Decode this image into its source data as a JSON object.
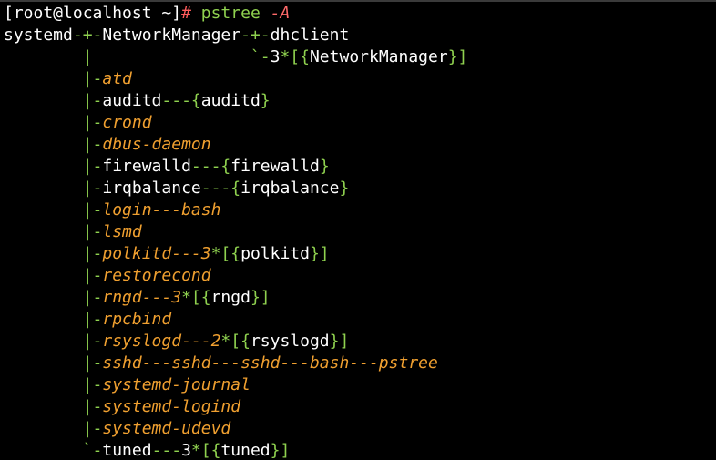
{
  "colors": {
    "background": "#000000",
    "default_text": "#ffffff",
    "tree_branch": "#8fd14f",
    "user_thread": "#f0a030",
    "prompt_hash": "#ff5c5c",
    "command": "#8fd14f",
    "argument": "#ff6a6a"
  },
  "terminal": {
    "lines": [
      [
        {
          "t": "[root@localhost ~]",
          "c": "default_text"
        },
        {
          "t": "#",
          "c": "prompt_hash"
        },
        {
          "t": " pstree ",
          "c": "command"
        },
        {
          "t": "-A",
          "c": "argument",
          "i": true
        }
      ],
      [
        {
          "t": "systemd",
          "c": "default_text"
        },
        {
          "t": "-+-",
          "c": "tree_branch"
        },
        {
          "t": "NetworkManager",
          "c": "default_text"
        },
        {
          "t": "-+-",
          "c": "tree_branch"
        },
        {
          "t": "dhclient",
          "c": "default_text"
        }
      ],
      [
        {
          "t": "        |                `-",
          "c": "tree_branch"
        },
        {
          "t": "3",
          "c": "default_text"
        },
        {
          "t": "*[{",
          "c": "tree_branch"
        },
        {
          "t": "NetworkManager",
          "c": "default_text"
        },
        {
          "t": "}]",
          "c": "tree_branch"
        }
      ],
      [
        {
          "t": "        |-",
          "c": "tree_branch"
        },
        {
          "t": "atd",
          "c": "user_thread",
          "i": true
        }
      ],
      [
        {
          "t": "        |-",
          "c": "tree_branch"
        },
        {
          "t": "auditd",
          "c": "default_text"
        },
        {
          "t": "---{",
          "c": "tree_branch"
        },
        {
          "t": "auditd",
          "c": "default_text"
        },
        {
          "t": "}",
          "c": "tree_branch"
        }
      ],
      [
        {
          "t": "        |-",
          "c": "tree_branch"
        },
        {
          "t": "crond",
          "c": "user_thread",
          "i": true
        }
      ],
      [
        {
          "t": "        |-",
          "c": "tree_branch"
        },
        {
          "t": "dbus-daemon",
          "c": "user_thread",
          "i": true
        }
      ],
      [
        {
          "t": "        |-",
          "c": "tree_branch"
        },
        {
          "t": "firewalld",
          "c": "default_text"
        },
        {
          "t": "---{",
          "c": "tree_branch"
        },
        {
          "t": "firewalld",
          "c": "default_text"
        },
        {
          "t": "}",
          "c": "tree_branch"
        }
      ],
      [
        {
          "t": "        |-",
          "c": "tree_branch"
        },
        {
          "t": "irqbalance",
          "c": "default_text"
        },
        {
          "t": "---{",
          "c": "tree_branch"
        },
        {
          "t": "irqbalance",
          "c": "default_text"
        },
        {
          "t": "}",
          "c": "tree_branch"
        }
      ],
      [
        {
          "t": "        |-",
          "c": "tree_branch"
        },
        {
          "t": "login---bash",
          "c": "user_thread",
          "i": true
        }
      ],
      [
        {
          "t": "        |-",
          "c": "tree_branch"
        },
        {
          "t": "lsmd",
          "c": "user_thread",
          "i": true
        }
      ],
      [
        {
          "t": "        |-",
          "c": "tree_branch"
        },
        {
          "t": "polkitd---3",
          "c": "user_thread",
          "i": true
        },
        {
          "t": "*[{",
          "c": "tree_branch"
        },
        {
          "t": "polkitd",
          "c": "default_text"
        },
        {
          "t": "}]",
          "c": "tree_branch"
        }
      ],
      [
        {
          "t": "        |-",
          "c": "tree_branch"
        },
        {
          "t": "restorecond",
          "c": "user_thread",
          "i": true
        }
      ],
      [
        {
          "t": "        |-",
          "c": "tree_branch"
        },
        {
          "t": "rngd---3",
          "c": "user_thread",
          "i": true
        },
        {
          "t": "*[{",
          "c": "tree_branch"
        },
        {
          "t": "rngd",
          "c": "default_text"
        },
        {
          "t": "}]",
          "c": "tree_branch"
        }
      ],
      [
        {
          "t": "        |-",
          "c": "tree_branch"
        },
        {
          "t": "rpcbind",
          "c": "user_thread",
          "i": true
        }
      ],
      [
        {
          "t": "        |-",
          "c": "tree_branch"
        },
        {
          "t": "rsyslogd---2",
          "c": "user_thread",
          "i": true
        },
        {
          "t": "*[{",
          "c": "tree_branch"
        },
        {
          "t": "rsyslogd",
          "c": "default_text"
        },
        {
          "t": "}]",
          "c": "tree_branch"
        }
      ],
      [
        {
          "t": "        |-",
          "c": "tree_branch"
        },
        {
          "t": "sshd---sshd---sshd---bash---pstree",
          "c": "user_thread",
          "i": true
        }
      ],
      [
        {
          "t": "        |-",
          "c": "tree_branch"
        },
        {
          "t": "systemd-journal",
          "c": "user_thread",
          "i": true
        }
      ],
      [
        {
          "t": "        |-",
          "c": "tree_branch"
        },
        {
          "t": "systemd-logind",
          "c": "user_thread",
          "i": true
        }
      ],
      [
        {
          "t": "        |-",
          "c": "tree_branch"
        },
        {
          "t": "systemd-udevd",
          "c": "user_thread",
          "i": true
        }
      ],
      [
        {
          "t": "        `-",
          "c": "tree_branch"
        },
        {
          "t": "tuned",
          "c": "default_text"
        },
        {
          "t": "---",
          "c": "tree_branch"
        },
        {
          "t": "3",
          "c": "default_text"
        },
        {
          "t": "*[{",
          "c": "tree_branch"
        },
        {
          "t": "tuned",
          "c": "default_text"
        },
        {
          "t": "}]",
          "c": "tree_branch"
        }
      ]
    ]
  }
}
